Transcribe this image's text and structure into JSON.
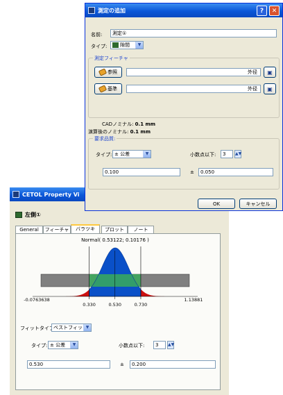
{
  "back": {
    "title": "CETOL Property Vi",
    "feature_name": "左側①",
    "tabs": [
      "General",
      "フィーチャ",
      "バラツキ",
      "プロット",
      "ノート"
    ],
    "active_tab": "バラツキ",
    "chart_title": "Normal( 0.53122; 0.10176 )",
    "fit_type_label": "フィットタイプ:",
    "fit_type_value": "ベストフィット",
    "type_label": "タイプ:",
    "type_value": "± 公差",
    "decimals_label": "小数点以下:",
    "decimals_value": "3",
    "nominal_value": "0.530",
    "pm_symbol": "±",
    "tolerance_value": "0.200"
  },
  "front": {
    "title": "測定の追加",
    "help_icon": "question-icon",
    "close_icon": "close-icon",
    "name_label": "名前:",
    "name_value": "測定①",
    "type_label": "タイプ:",
    "type_value": "隙間",
    "feature_group_label": "測定フィーチャ",
    "ref_button": "参照",
    "ref_value": "外径",
    "base_button": "基準",
    "base_value": "外径",
    "cad_nominal_label": "CADノミナル:",
    "cad_nominal_value": "0.1 mm",
    "rounded_nominal_label": "演算後のノミナル:",
    "rounded_nominal_value": "0.1 mm",
    "quality_group_label": "要求品質:",
    "q_type_label": "タイプ:",
    "q_type_value": "± 公差",
    "q_decimals_label": "小数点以下:",
    "q_decimals_value": "3",
    "q_nominal_value": "0.100",
    "q_pm_symbol": "±",
    "q_tolerance_value": "0.050",
    "ok_button": "OK",
    "cancel_button": "キャンセル"
  },
  "chart_data": {
    "type": "area",
    "title": "Normal( 0.53122; 0.10176 )",
    "distribution": "normal",
    "mean": 0.53122,
    "std_dev": 0.10176,
    "xlim": [
      -0.0763638,
      1.13881
    ],
    "x_ticks": [
      "-0.0763638",
      "0.330",
      "0.530",
      "0.730",
      "1.13881"
    ],
    "spec_limits": [
      0.33,
      0.73
    ],
    "nominal": 0.53,
    "colors": {
      "in_spec": "#0a50c8",
      "out_of_spec": "#cc1010",
      "band": "#808080",
      "band_overlap": "#3aaa5a"
    }
  }
}
